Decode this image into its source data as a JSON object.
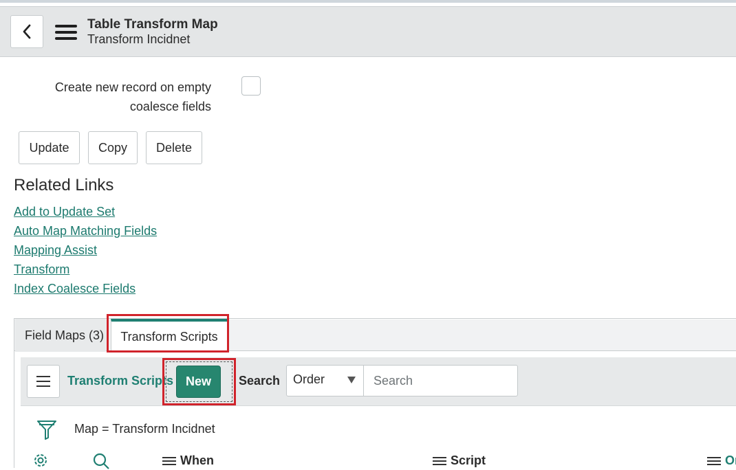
{
  "header": {
    "title": "Table Transform Map",
    "subtitle": "Transform Incidnet"
  },
  "form": {
    "create_new_record_label": "Create new record on empty coalesce fields",
    "create_new_record_checked": false,
    "buttons": {
      "update": "Update",
      "copy": "Copy",
      "delete": "Delete"
    }
  },
  "related_links": {
    "title": "Related Links",
    "links": [
      "Add to Update Set",
      "Auto Map Matching Fields",
      "Mapping Assist",
      "Transform",
      "Index Coalesce Fields"
    ]
  },
  "tabs": [
    {
      "label": "Field Maps (3)",
      "active": false
    },
    {
      "label": "Transform Scripts",
      "active": true
    }
  ],
  "list": {
    "title": "Transform Scripts",
    "new_label": "New",
    "search_label": "Search",
    "search_field_selected": "Order",
    "search_placeholder": "Search",
    "filter_text": "Map = Transform Incidnet",
    "columns": [
      "When",
      "Script",
      "Or"
    ]
  },
  "icons": {
    "back": "chevron-left-icon",
    "menu": "hamburger-icon",
    "filter": "funnel-icon",
    "settings": "gear-icon",
    "search": "magnifier-icon"
  },
  "colors": {
    "accent": "#1f7f72",
    "new_button": "#27866f",
    "highlight": "#d0232b"
  }
}
